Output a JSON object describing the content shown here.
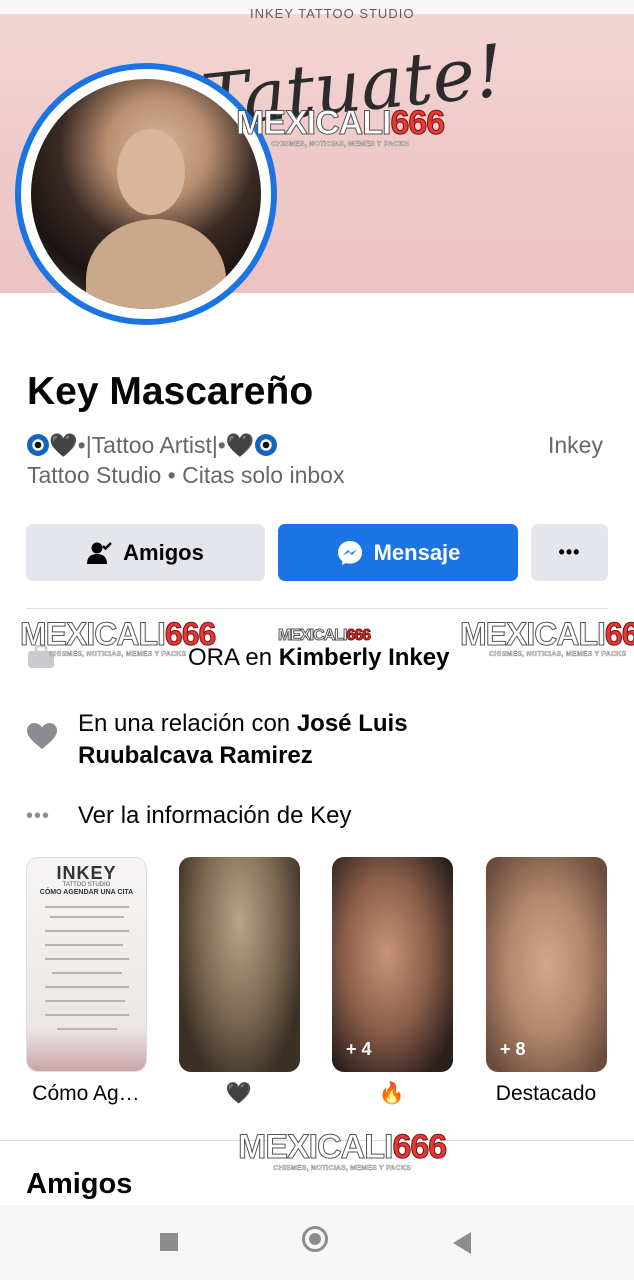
{
  "cover": {
    "studio": "INKEY TATTOO STUDIO",
    "script_text": "Tatuate!",
    "accent": "#1b74e4"
  },
  "watermark": {
    "brand": "MEXICALI",
    "number": "666",
    "tagline": "CHISMES, NOTICIAS, MEMES Y PACKS"
  },
  "profile": {
    "name": "Key Mascareño",
    "bio_line1": "•|Tattoo Artist|•",
    "bio_right": "Inkey",
    "bio_line2": "Tattoo Studio • Citas solo inbox"
  },
  "actions": {
    "friends_label": "Amigos",
    "message_label": "Mensaje",
    "more_label": "•••"
  },
  "intro": {
    "work_prefix": "ORA en",
    "work_place": "Kimberly Inkey",
    "relationship_prefix": "En una relación con",
    "relationship_name_1": "José Luis",
    "relationship_name_2": "Ruubalcava Ramirez",
    "see_info": "Ver la información de Key"
  },
  "highlights": [
    {
      "label": "Cómo Ag…",
      "count": "",
      "doc_title": "INKEY",
      "doc_sub": "TATTOO STUDIO",
      "doc_sub2": "CÓMO AGENDAR UNA CITA"
    },
    {
      "label": "🖤",
      "count": ""
    },
    {
      "label": "🔥",
      "count": "+ 4"
    },
    {
      "label": "Destacado",
      "count": "+ 8"
    }
  ],
  "sections": {
    "friends_title": "Amigos"
  },
  "icons": [
    "user-check-icon",
    "messenger-icon",
    "more-icon",
    "work-icon",
    "heart-icon",
    "dots-icon",
    "nav-recent-icon",
    "nav-home-icon",
    "nav-back-icon"
  ]
}
